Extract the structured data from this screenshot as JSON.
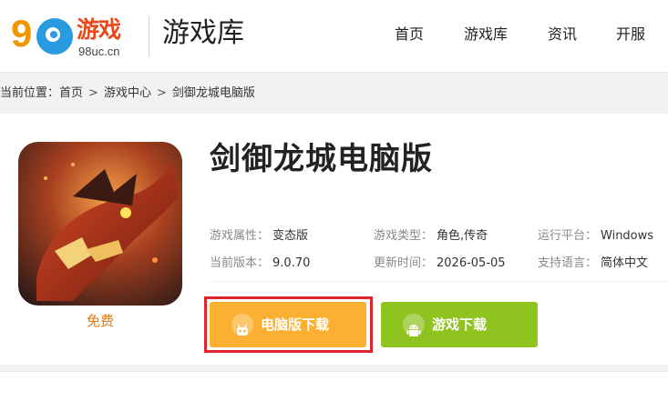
{
  "header": {
    "logo": {
      "text": "游戏",
      "sub": "98uc.cn",
      "digit": "9"
    },
    "section_title": "游戏库",
    "nav": [
      {
        "label": "首页"
      },
      {
        "label": "游戏库"
      },
      {
        "label": "资讯"
      },
      {
        "label": "开服"
      }
    ]
  },
  "breadcrumb": {
    "prefix": "当前位置：",
    "items": [
      "首页",
      "游戏中心",
      "剑御龙城电脑版"
    ],
    "separator": ">"
  },
  "game": {
    "title": "剑御龙城电脑版",
    "price_label": "免费",
    "info": [
      {
        "key": "游戏属性：",
        "value": "变态版"
      },
      {
        "key": "游戏类型：",
        "value": "角色,传奇"
      },
      {
        "key": "运行平台：",
        "value": "Windows"
      },
      {
        "key": "当前版本：",
        "value": "9.0.70"
      },
      {
        "key": "更新时间：",
        "value": "2026-05-05"
      },
      {
        "key": "支持语言：",
        "value": "简体中文"
      }
    ],
    "buttons": {
      "pc_download": "电脑版下载",
      "game_download": "游戏下载"
    }
  },
  "colors": {
    "brand_orange": "#f29600",
    "brand_blue": "#2a9be0",
    "pc_button": "#fbb032",
    "game_button": "#8fc31f",
    "highlight": "#e0262c",
    "free_label": "#e8760e"
  },
  "icons": {
    "pc_button_icon": "robot-icon",
    "game_button_icon": "android-icon"
  }
}
